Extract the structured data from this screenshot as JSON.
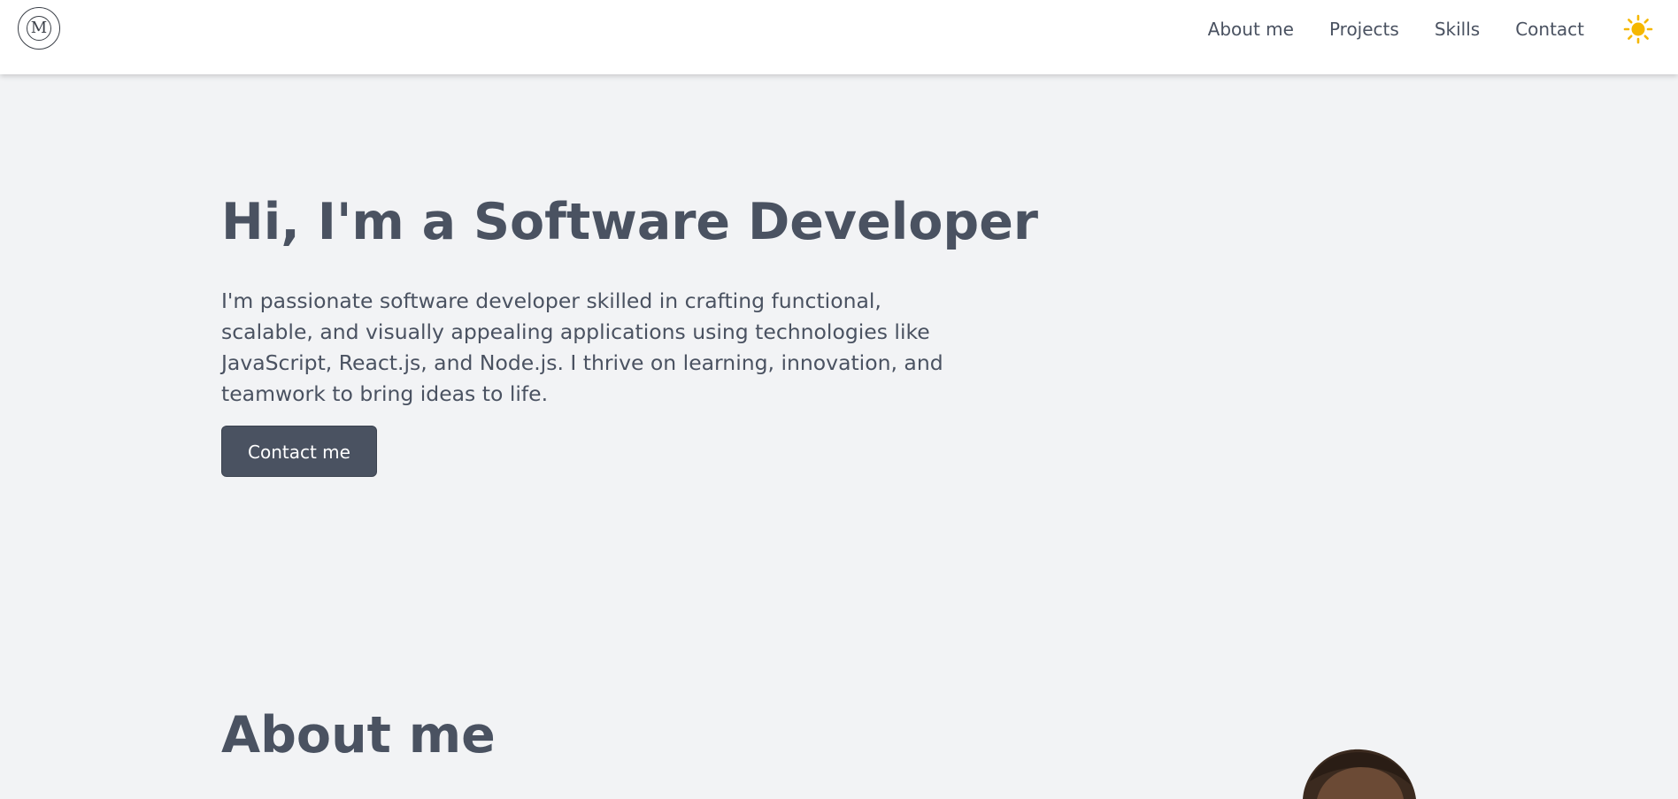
{
  "header": {
    "logo_letter": "M",
    "nav": [
      "About me",
      "Projects",
      "Skills",
      "Contact"
    ],
    "theme_icon": "sun-icon",
    "theme_color": "#f5b700"
  },
  "hero": {
    "title": "Hi, I'm a Software Developer",
    "text": "I'm passionate software developer skilled in crafting functional, scalable, and visually appealing applications using technologies like JavaScript, React.js, and Node.js. I thrive on learning, innovation, and teamwork to bring ideas to life.",
    "button": "Contact me"
  },
  "about": {
    "title": "About me"
  },
  "colors": {
    "page_bg": "#f2f3f5",
    "text": "#4a5261",
    "button_bg": "#4a5261"
  }
}
